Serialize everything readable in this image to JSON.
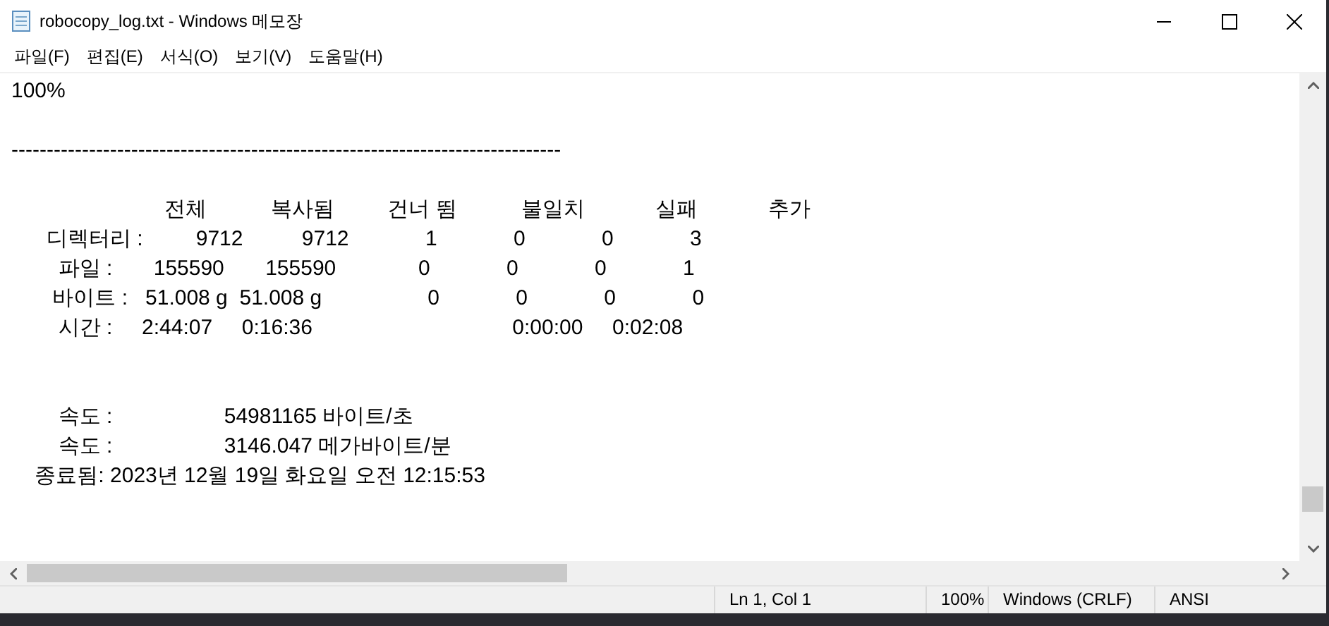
{
  "window": {
    "title": "robocopy_log.txt - Windows 메모장"
  },
  "menu": [
    {
      "label": "파일(F)"
    },
    {
      "label": "편집(E)"
    },
    {
      "label": "서식(O)"
    },
    {
      "label": "보기(V)"
    },
    {
      "label": "도움말(H)"
    }
  ],
  "editor": {
    "lines": [
      {
        "kind": "text",
        "text": "100%"
      },
      {
        "kind": "blank"
      },
      {
        "kind": "text",
        "text": "------------------------------------------------------------------------------"
      },
      {
        "kind": "blank"
      },
      {
        "kind": "text",
        "text": "                          전체           복사됨         건너 뜀           불일치            실패            추가"
      },
      {
        "kind": "text",
        "text": "      디렉터리 :         9712          9712             1             0             0             3"
      },
      {
        "kind": "text",
        "text": "        파일 :       155590       155590              0             0             0             1"
      },
      {
        "kind": "text",
        "text": "       바이트 :   51.008 g  51.008 g                  0             0             0             0"
      },
      {
        "kind": "text",
        "text": "        시간 :     2:44:07     0:16:36                                  0:00:00     0:02:08"
      },
      {
        "kind": "blank"
      },
      {
        "kind": "blank"
      },
      {
        "kind": "text",
        "text": "        속도 :                   54981165 바이트/초"
      },
      {
        "kind": "text",
        "text": "        속도 :                   3146.047 메가바이트/분"
      },
      {
        "kind": "text",
        "text": "    종료됨: 2023년 12월 19일 화요일 오전 12:15:53"
      }
    ]
  },
  "status_bar": [
    {
      "text": "Ln 1, Col 1"
    },
    {
      "text": "100%"
    },
    {
      "text": "Windows (CRLF)"
    },
    {
      "text": "ANSI"
    }
  ]
}
